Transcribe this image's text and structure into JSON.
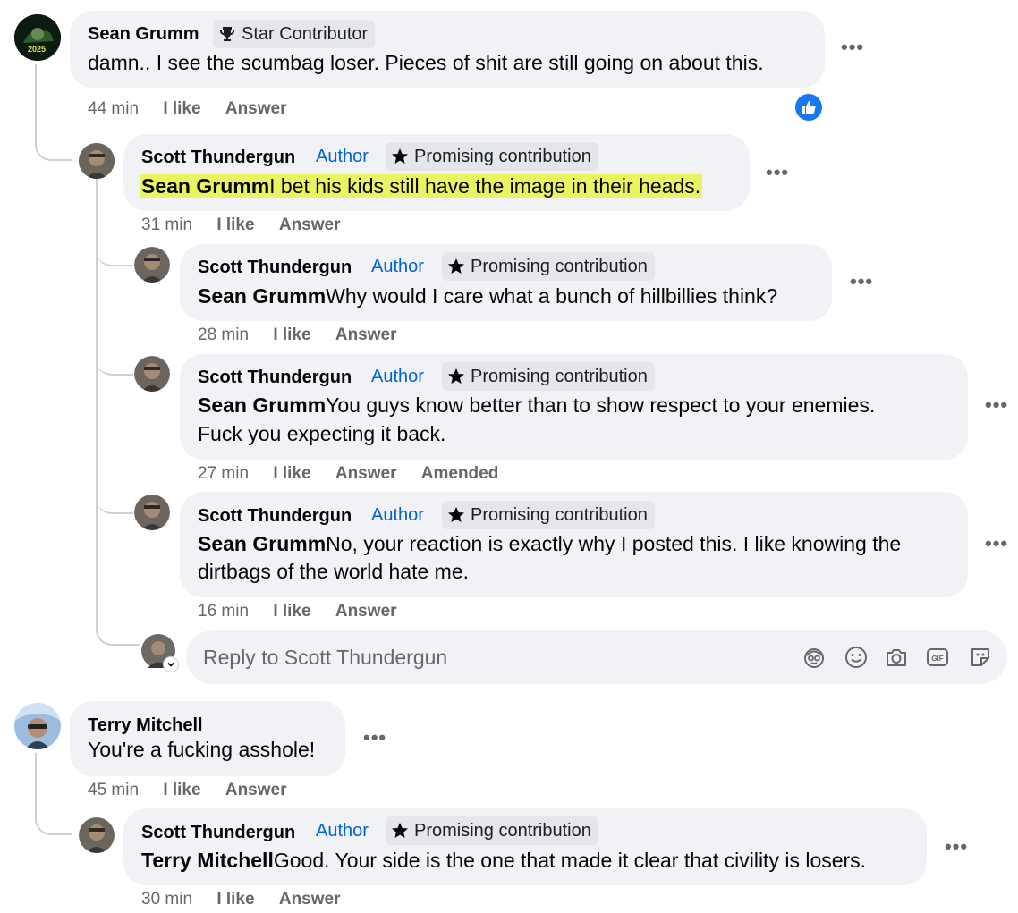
{
  "colors": {
    "author": "#0064d1",
    "highlight": "#eaf360",
    "bubble": "#f0f2f5",
    "like_reaction": "#1877f2"
  },
  "comment1": {
    "name": "Sean Grumm",
    "badge_icon": "trophy-icon",
    "badge": "Star Contributor",
    "text": "damn.. I see the scumbag loser. Pieces of shit are still going on about this.",
    "avatar_label": "2025",
    "time": "44 min",
    "like": "I like",
    "answer": "Answer",
    "reaction_icon": "thumbs-up-reaction-icon"
  },
  "reply1": {
    "name": "Scott Thundergun",
    "author": "Author",
    "badge": "Promising contribution",
    "mention": "Sean Grumm",
    "text": "I bet his kids still have the image in their heads.",
    "time": "31 min",
    "like": "I like",
    "answer": "Answer"
  },
  "reply2": {
    "name": "Scott Thundergun",
    "author": "Author",
    "badge": "Promising contribution",
    "mention": "Sean Grumm",
    "text": "Why would I care what a bunch of hillbillies think?",
    "time": "28 min",
    "like": "I like",
    "answer": "Answer"
  },
  "reply3": {
    "name": "Scott Thundergun",
    "author": "Author",
    "badge": "Promising contribution",
    "mention": "Sean Grumm",
    "text": "You guys know better than to show respect to your enemies.",
    "text2": "Fuck you expecting it back.",
    "time": "27 min",
    "like": "I like",
    "answer": "Answer",
    "amended": "Amended"
  },
  "reply4": {
    "name": "Scott Thundergun",
    "author": "Author",
    "badge": "Promising contribution",
    "mention": "Sean Grumm",
    "text": "No, your reaction is exactly why I posted this. I like knowing the",
    "text2": "dirtbags of the world hate me.",
    "time": "16 min",
    "like": "I like",
    "answer": "Answer"
  },
  "reply_box": {
    "placeholder": "Reply to Scott Thundergun",
    "icons": [
      "avatar-sticker-icon",
      "emoji-icon",
      "camera-icon",
      "gif-icon",
      "sticker-icon"
    ]
  },
  "comment2": {
    "name": "Terry Mitchell",
    "text": "You're a fucking asshole!",
    "time": "45 min",
    "like": "I like",
    "answer": "Answer"
  },
  "reply5": {
    "name": "Scott Thundergun",
    "author": "Author",
    "badge": "Promising contribution",
    "mention": "Terry Mitchell",
    "text": "Good. Your side is the one that made it clear that civility is losers.",
    "time": "30 min",
    "like": "I like",
    "answer": "Answer"
  }
}
